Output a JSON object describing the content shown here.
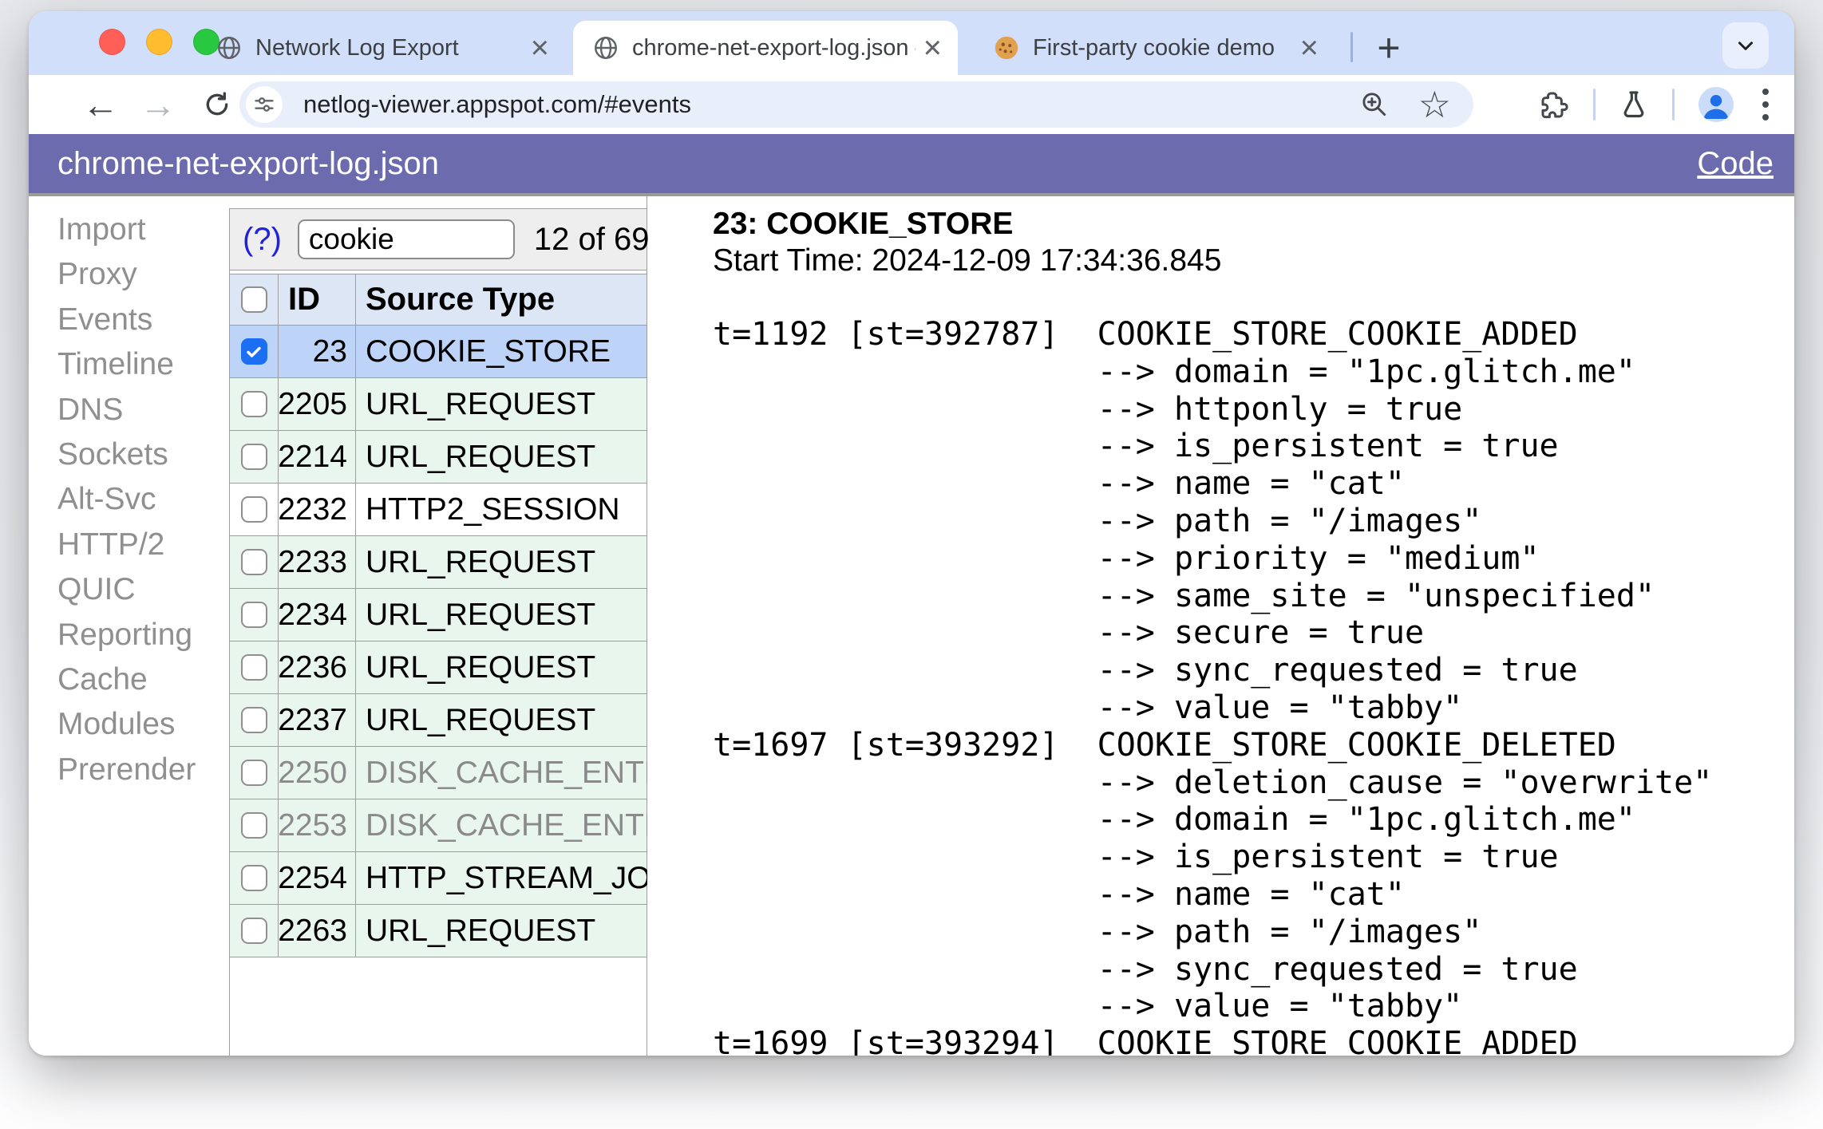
{
  "browser": {
    "tabs": [
      {
        "title": "Network Log Export",
        "favicon": "globe",
        "state": "inactive"
      },
      {
        "title": "chrome-net-export-log.json –",
        "favicon": "globe",
        "state": "active"
      },
      {
        "title": "First-party cookie demo",
        "favicon": "cookie",
        "state": "inactive"
      }
    ],
    "new_tab_button": "+",
    "address_bar": {
      "url": "netlog-viewer.appspot.com/#events"
    }
  },
  "app_header": {
    "filename": "chrome-net-export-log.json",
    "code_link_label": "Code"
  },
  "sidebar": {
    "items": [
      "Import",
      "Proxy",
      "Events",
      "Timeline",
      "DNS",
      "Sockets",
      "Alt-Svc",
      "HTTP/2",
      "QUIC",
      "Reporting",
      "Cache",
      "Modules",
      "Prerender"
    ]
  },
  "filter": {
    "help_label": "(?)",
    "query": "cookie",
    "result_count": "12 of 69"
  },
  "events_table": {
    "columns": [
      "ID",
      "Source Type"
    ],
    "rows": [
      {
        "id": "23",
        "source_type": "COOKIE_STORE",
        "checked": true,
        "style": "selected",
        "muted": false
      },
      {
        "id": "2205",
        "source_type": "URL_REQUEST",
        "checked": false,
        "style": "green",
        "muted": false
      },
      {
        "id": "2214",
        "source_type": "URL_REQUEST",
        "checked": false,
        "style": "green",
        "muted": false
      },
      {
        "id": "2232",
        "source_type": "HTTP2_SESSION",
        "checked": false,
        "style": "plain",
        "muted": false
      },
      {
        "id": "2233",
        "source_type": "URL_REQUEST",
        "checked": false,
        "style": "green",
        "muted": false
      },
      {
        "id": "2234",
        "source_type": "URL_REQUEST",
        "checked": false,
        "style": "green",
        "muted": false
      },
      {
        "id": "2236",
        "source_type": "URL_REQUEST",
        "checked": false,
        "style": "green",
        "muted": false
      },
      {
        "id": "2237",
        "source_type": "URL_REQUEST",
        "checked": false,
        "style": "green",
        "muted": false
      },
      {
        "id": "2250",
        "source_type": "DISK_CACHE_ENTRY",
        "checked": false,
        "style": "green",
        "muted": true
      },
      {
        "id": "2253",
        "source_type": "DISK_CACHE_ENTRY",
        "checked": false,
        "style": "green",
        "muted": true
      },
      {
        "id": "2254",
        "source_type": "HTTP_STREAM_JOB",
        "checked": false,
        "style": "green",
        "muted": false
      },
      {
        "id": "2263",
        "source_type": "URL_REQUEST",
        "checked": false,
        "style": "green",
        "muted": false
      }
    ]
  },
  "details": {
    "title": "23: COOKIE_STORE",
    "start_time": "Start Time: 2024-12-09 17:34:36.845",
    "log": "t=1192 [st=392787]  COOKIE_STORE_COOKIE_ADDED\n                    --> domain = \"1pc.glitch.me\"\n                    --> httponly = true\n                    --> is_persistent = true\n                    --> name = \"cat\"\n                    --> path = \"/images\"\n                    --> priority = \"medium\"\n                    --> same_site = \"unspecified\"\n                    --> secure = true\n                    --> sync_requested = true\n                    --> value = \"tabby\"\nt=1697 [st=393292]  COOKIE_STORE_COOKIE_DELETED\n                    --> deletion_cause = \"overwrite\"\n                    --> domain = \"1pc.glitch.me\"\n                    --> is_persistent = true\n                    --> name = \"cat\"\n                    --> path = \"/images\"\n                    --> sync_requested = true\n                    --> value = \"tabby\"\nt=1699 [st=393294]  COOKIE_STORE_COOKIE_ADDED"
  },
  "colors": {
    "tab_strip": "#d1dffb",
    "app_header": "#6b6bad",
    "header_row": "#dde6f5",
    "selected_row": "#bed3f8",
    "active_row": "#e9f6ed",
    "checkbox_checked": "#1c6ef3",
    "link_blue": "#2222dd"
  }
}
